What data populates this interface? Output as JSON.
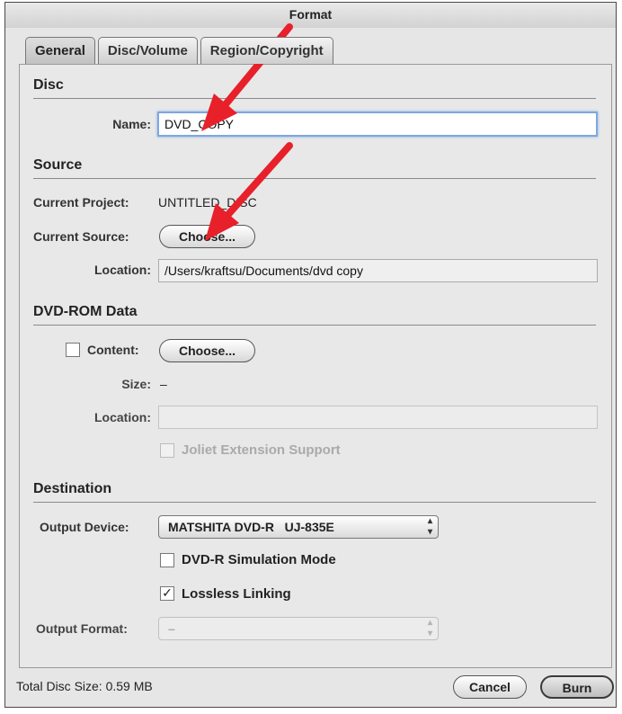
{
  "window": {
    "title": "Format"
  },
  "tabs": [
    {
      "label": "General"
    },
    {
      "label": "Disc/Volume"
    },
    {
      "label": "Region/Copyright"
    }
  ],
  "disc": {
    "heading": "Disc",
    "name_label": "Name:",
    "name_value": "DVD_COPY"
  },
  "source": {
    "heading": "Source",
    "current_project_label": "Current Project:",
    "current_project_value": "UNTITLED_DISC",
    "current_source_label": "Current Source:",
    "choose_label": "Choose...",
    "location_label": "Location:",
    "location_value": "/Users/kraftsu/Documents/dvd copy"
  },
  "dvdrom": {
    "heading": "DVD-ROM Data",
    "content_label": "Content:",
    "choose_label": "Choose...",
    "size_label": "Size:",
    "size_value": "–",
    "location_label": "Location:",
    "location_value": "",
    "joliet_label": "Joliet Extension Support"
  },
  "destination": {
    "heading": "Destination",
    "output_device_label": "Output Device:",
    "output_device_value": "MATSHITA DVD-R   UJ-835E",
    "sim_mode_label": "DVD-R Simulation Mode",
    "sim_mode_checked": false,
    "lossless_label": "Lossless Linking",
    "lossless_checked": true,
    "output_format_label": "Output Format:",
    "output_format_value": "–"
  },
  "footer": {
    "total_size_label": "Total Disc Size: 0.59 MB",
    "cancel_label": "Cancel",
    "burn_label": "Burn"
  },
  "colors": {
    "annotation_arrow": "#e8202a",
    "focus_ring": "#7ea7de"
  }
}
